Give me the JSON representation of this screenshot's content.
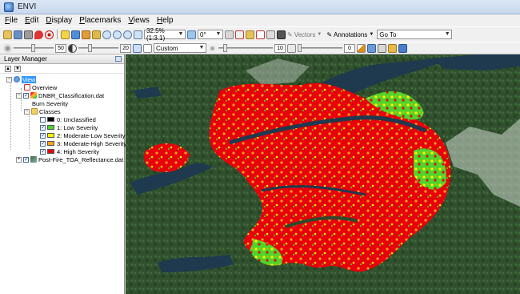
{
  "window": {
    "title": "ENVI"
  },
  "menu": [
    "File",
    "Edit",
    "Display",
    "Placemarks",
    "Views",
    "Help"
  ],
  "toolbar": {
    "zoom_value": "32.5% (1:3.1)",
    "rotation_value": "0°",
    "vectors_label": "Vectors",
    "annotations_label": "Annotations",
    "goto_label": "Go To",
    "goto_value": "",
    "stretch_value": "Custom",
    "slider1_value": "50",
    "slider2_value": "20",
    "slider3_value": "10",
    "slider4_value": "0"
  },
  "layer_manager": {
    "title": "Layer Manager",
    "tree": [
      {
        "id": "view",
        "label": "View"
      },
      {
        "id": "overview",
        "label": "Overview"
      },
      {
        "id": "dnbr",
        "label": "DNBR_Classification.dat"
      },
      {
        "id": "burn",
        "label": "Burn Severity"
      },
      {
        "id": "classes",
        "label": "Classes"
      },
      {
        "id": "c0",
        "label": "0: Unclassified",
        "color": "#000000"
      },
      {
        "id": "c1",
        "label": "1: Low Severity",
        "color": "#4cd62a"
      },
      {
        "id": "c2",
        "label": "2: Moderate-Low Severity",
        "color": "#f5f000"
      },
      {
        "id": "c3",
        "label": "3: Moderate-High Severity",
        "color": "#ffa21c"
      },
      {
        "id": "c4",
        "label": "4: High Severity",
        "color": "#e8000b"
      },
      {
        "id": "toa",
        "label": "Post-Fire_TOA_Reflectance.dat"
      }
    ]
  },
  "colors": {
    "forest": "#2f4d2c",
    "water": "#1f3a4f",
    "high": "#e8000b",
    "moderate_high": "#ffa21c",
    "moderate_low": "#f5f000",
    "low": "#4cd62a",
    "selection": "#3399ff"
  }
}
